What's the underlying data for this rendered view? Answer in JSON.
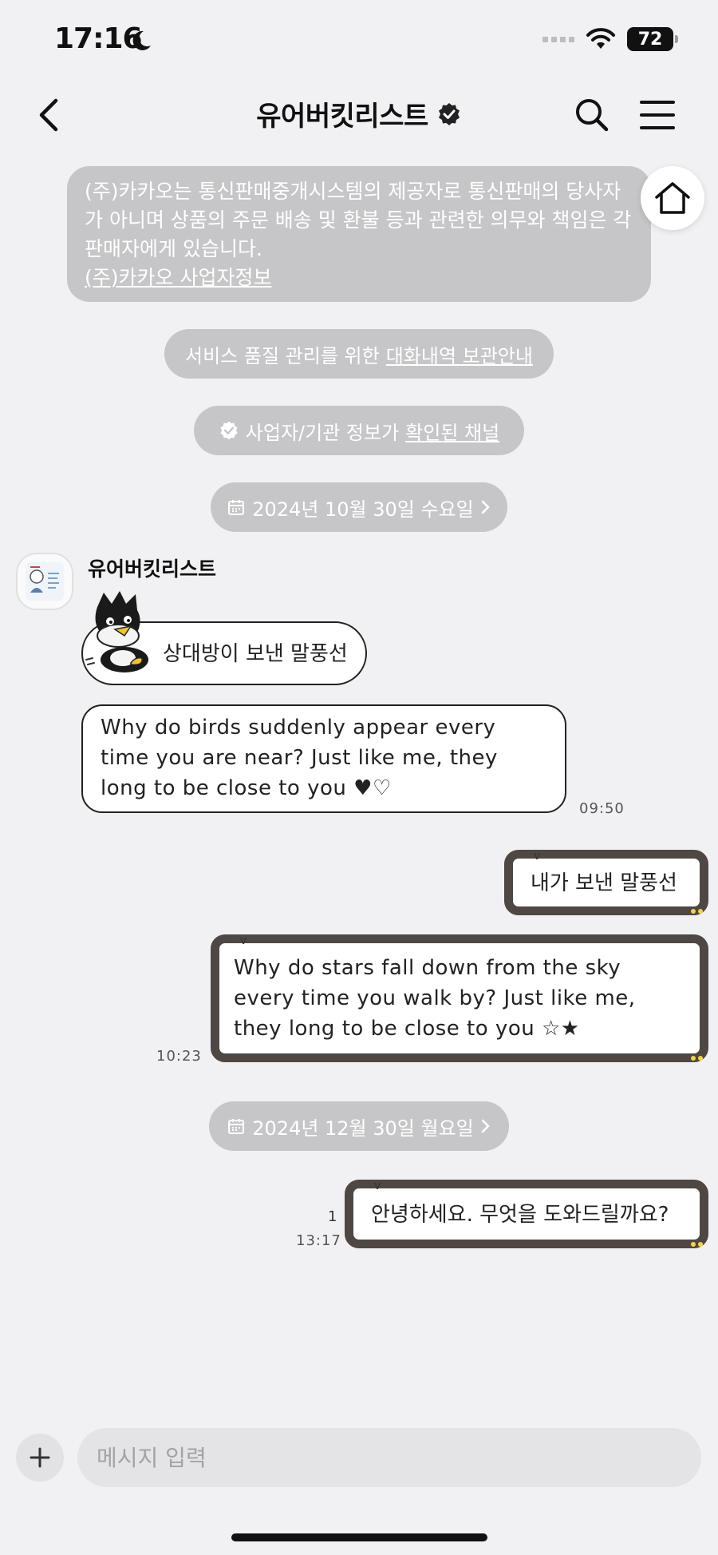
{
  "status_bar": {
    "time": "17:16",
    "battery": "72"
  },
  "header": {
    "title": "유어버킷리스트"
  },
  "notice": {
    "text": "(주)카카오는 통신판매중개시스템의 제공자로 통신판매의 당사자가 아니며 상품의 주문 배송 및 환불 등과 관련한 의무와 책임은 각 판매자에게 있습니다.",
    "link": "(주)카카오 사업자정보"
  },
  "storage_pill": {
    "prefix": "서비스 품질 관리를 위한",
    "link": "대화내역 보관안내"
  },
  "verified_pill": {
    "prefix": "사업자/기관 정보가",
    "link": "확인된 채널"
  },
  "dates": {
    "first": "2024년 10월 30일 수요일",
    "second": "2024년 12월 30일 월요일"
  },
  "sender": {
    "name": "유어버킷리스트"
  },
  "messages": {
    "in1": "상대방이 보낸 말풍선",
    "in2_l1": "Why do birds suddenly appear every",
    "in2_l2": "time you are near? Just like me, they",
    "in2_l3": "long to be close to you ♥♡",
    "in_time": "09:50",
    "out1": "내가 보낸 말풍선",
    "out2_l1": "Why do stars fall down from the sky",
    "out2_l2": "every time you walk by? Just like me,",
    "out2_l3": "they long to be close to you ☆★",
    "out2_time": "10:23",
    "out3": "안녕하세요. 무엇을 도와드릴까요?",
    "out3_read": "1",
    "out3_time": "13:17"
  },
  "input": {
    "placeholder": "메시지 입력"
  }
}
